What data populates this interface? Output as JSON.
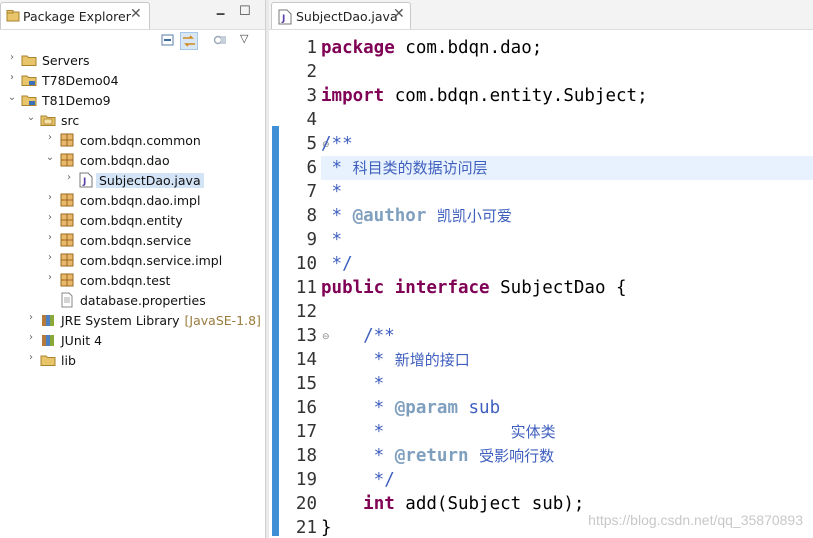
{
  "explorer": {
    "tab_title": "Package Explorer",
    "tab_close": "✕",
    "minimize": "🗕",
    "maximize": "☐",
    "menu": "▽",
    "tree": [
      {
        "label": "Servers",
        "arrow": "›",
        "icon": "folder"
      },
      {
        "label": "T78Demo04",
        "arrow": "›",
        "icon": "project"
      },
      {
        "label": "T81Demo9",
        "arrow": "⌄",
        "icon": "project"
      },
      {
        "label": "src",
        "arrow": "⌄",
        "icon": "source-folder"
      },
      {
        "label": "com.bdqn.common",
        "arrow": "›",
        "icon": "package"
      },
      {
        "label": "com.bdqn.dao",
        "arrow": "⌄",
        "icon": "package"
      },
      {
        "label": "SubjectDao.java",
        "arrow": "›",
        "icon": "java-file"
      },
      {
        "label": "com.bdqn.dao.impl",
        "arrow": "›",
        "icon": "package"
      },
      {
        "label": "com.bdqn.entity",
        "arrow": "›",
        "icon": "package"
      },
      {
        "label": "com.bdqn.service",
        "arrow": "›",
        "icon": "package"
      },
      {
        "label": "com.bdqn.service.impl",
        "arrow": "›",
        "icon": "package"
      },
      {
        "label": "com.bdqn.test",
        "arrow": "›",
        "icon": "package"
      },
      {
        "label": "database.properties",
        "arrow": "",
        "icon": "file"
      },
      {
        "label": "JRE System Library",
        "deco": "[JavaSE-1.8]",
        "arrow": "›",
        "icon": "library"
      },
      {
        "label": "JUnit 4",
        "arrow": "›",
        "icon": "library"
      },
      {
        "label": "lib",
        "arrow": "›",
        "icon": "folder"
      }
    ]
  },
  "editor": {
    "tab_title": "SubjectDao.java",
    "tab_close": "✕",
    "lines": [
      {
        "n": "1",
        "t": "package com.bdqn.dao;"
      },
      {
        "n": "2",
        "t": ""
      },
      {
        "n": "3",
        "t": "import com.bdqn.entity.Subject;"
      },
      {
        "n": "4",
        "t": ""
      },
      {
        "n": "5",
        "t": "/**"
      },
      {
        "n": "6",
        "t": " * 科目类的数据访问层"
      },
      {
        "n": "7",
        "t": " *"
      },
      {
        "n": "8",
        "t": " * @author 凯凯小可爱"
      },
      {
        "n": "9",
        "t": " *"
      },
      {
        "n": "10",
        "t": " */"
      },
      {
        "n": "11",
        "t": "public interface SubjectDao {"
      },
      {
        "n": "12",
        "t": ""
      },
      {
        "n": "13",
        "t": "    /**"
      },
      {
        "n": "14",
        "t": "     * 新增的接口"
      },
      {
        "n": "15",
        "t": "     *"
      },
      {
        "n": "16",
        "t": "     * @param sub"
      },
      {
        "n": "17",
        "t": "     *            实体类"
      },
      {
        "n": "18",
        "t": "     * @return 受影响行数"
      },
      {
        "n": "19",
        "t": "     */"
      },
      {
        "n": "20",
        "t": "    int add(Subject sub);"
      },
      {
        "n": "21",
        "t": "}"
      }
    ],
    "watermark": "https://blog.csdn.net/qq_35870893"
  }
}
